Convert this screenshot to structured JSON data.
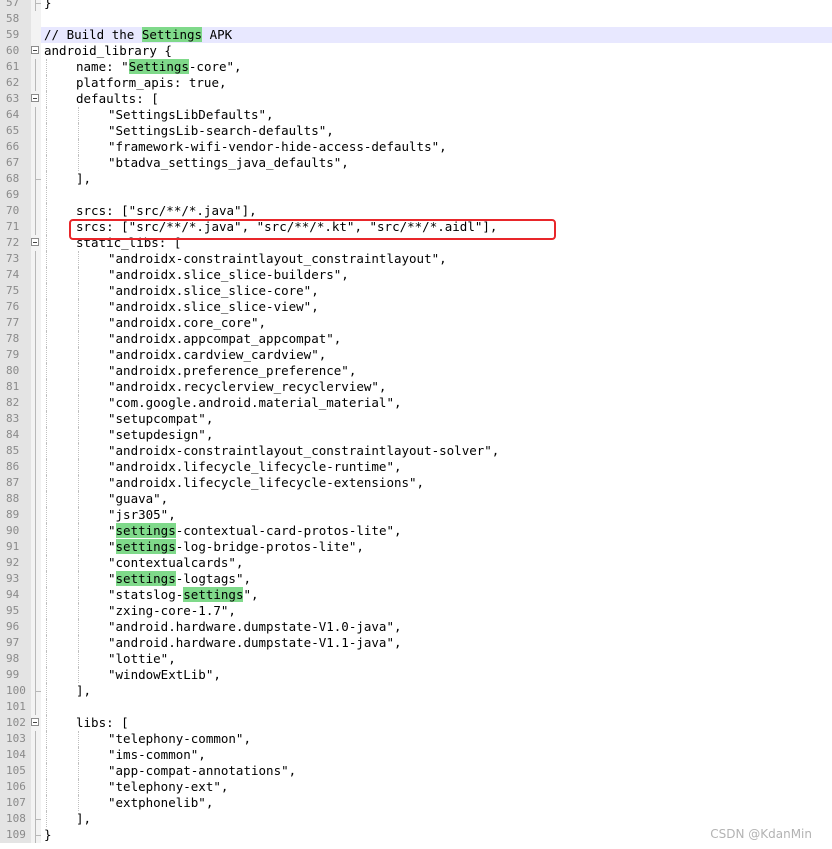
{
  "editor": {
    "lines": [
      {
        "n": "57",
        "text": "}",
        "indent": 0
      },
      {
        "n": "58",
        "text": "",
        "indent": 0
      },
      {
        "n": "59",
        "text": "// Build the Settings APK",
        "indent": 0,
        "highlight": "Settings",
        "current": true
      },
      {
        "n": "60",
        "text": "android_library {",
        "indent": 0
      },
      {
        "n": "61",
        "text": "name: \"Settings-core\",",
        "indent": 1,
        "highlight": "Settings"
      },
      {
        "n": "62",
        "text": "platform_apis: true,",
        "indent": 1
      },
      {
        "n": "63",
        "text": "defaults: [",
        "indent": 1
      },
      {
        "n": "64",
        "text": "\"SettingsLibDefaults\",",
        "indent": 2
      },
      {
        "n": "65",
        "text": "\"SettingsLib-search-defaults\",",
        "indent": 2
      },
      {
        "n": "66",
        "text": "\"framework-wifi-vendor-hide-access-defaults\",",
        "indent": 2
      },
      {
        "n": "67",
        "text": "\"btadva_settings_java_defaults\",",
        "indent": 2
      },
      {
        "n": "68",
        "text": "],",
        "indent": 1
      },
      {
        "n": "69",
        "text": "",
        "indent": 1
      },
      {
        "n": "70",
        "text": "srcs: [\"src/**/*.java\"],",
        "indent": 1
      },
      {
        "n": "71",
        "text": "srcs: [\"src/**/*.java\", \"src/**/*.kt\", \"src/**/*.aidl\"],",
        "indent": 1
      },
      {
        "n": "72",
        "text": "static_libs: [",
        "indent": 1
      },
      {
        "n": "73",
        "text": "\"androidx-constraintlayout_constraintlayout\",",
        "indent": 2
      },
      {
        "n": "74",
        "text": "\"androidx.slice_slice-builders\",",
        "indent": 2
      },
      {
        "n": "75",
        "text": "\"androidx.slice_slice-core\",",
        "indent": 2
      },
      {
        "n": "76",
        "text": "\"androidx.slice_slice-view\",",
        "indent": 2
      },
      {
        "n": "77",
        "text": "\"androidx.core_core\",",
        "indent": 2
      },
      {
        "n": "78",
        "text": "\"androidx.appcompat_appcompat\",",
        "indent": 2
      },
      {
        "n": "79",
        "text": "\"androidx.cardview_cardview\",",
        "indent": 2
      },
      {
        "n": "80",
        "text": "\"androidx.preference_preference\",",
        "indent": 2
      },
      {
        "n": "81",
        "text": "\"androidx.recyclerview_recyclerview\",",
        "indent": 2
      },
      {
        "n": "82",
        "text": "\"com.google.android.material_material\",",
        "indent": 2
      },
      {
        "n": "83",
        "text": "\"setupcompat\",",
        "indent": 2
      },
      {
        "n": "84",
        "text": "\"setupdesign\",",
        "indent": 2
      },
      {
        "n": "85",
        "text": "\"androidx-constraintlayout_constraintlayout-solver\",",
        "indent": 2
      },
      {
        "n": "86",
        "text": "\"androidx.lifecycle_lifecycle-runtime\",",
        "indent": 2
      },
      {
        "n": "87",
        "text": "\"androidx.lifecycle_lifecycle-extensions\",",
        "indent": 2
      },
      {
        "n": "88",
        "text": "\"guava\",",
        "indent": 2
      },
      {
        "n": "89",
        "text": "\"jsr305\",",
        "indent": 2
      },
      {
        "n": "90",
        "text": "\"settings-contextual-card-protos-lite\",",
        "indent": 2,
        "highlight": "settings"
      },
      {
        "n": "91",
        "text": "\"settings-log-bridge-protos-lite\",",
        "indent": 2,
        "highlight": "settings"
      },
      {
        "n": "92",
        "text": "\"contextualcards\",",
        "indent": 2
      },
      {
        "n": "93",
        "text": "\"settings-logtags\",",
        "indent": 2,
        "highlight": "settings"
      },
      {
        "n": "94",
        "text": "\"statslog-settings\",",
        "indent": 2,
        "highlight": "settings"
      },
      {
        "n": "95",
        "text": "\"zxing-core-1.7\",",
        "indent": 2
      },
      {
        "n": "96",
        "text": "\"android.hardware.dumpstate-V1.0-java\",",
        "indent": 2
      },
      {
        "n": "97",
        "text": "\"android.hardware.dumpstate-V1.1-java\",",
        "indent": 2
      },
      {
        "n": "98",
        "text": "\"lottie\",",
        "indent": 2
      },
      {
        "n": "99",
        "text": "\"windowExtLib\",",
        "indent": 2
      },
      {
        "n": "100",
        "text": "],",
        "indent": 1
      },
      {
        "n": "101",
        "text": "",
        "indent": 1
      },
      {
        "n": "102",
        "text": "libs: [",
        "indent": 1
      },
      {
        "n": "103",
        "text": "\"telephony-common\",",
        "indent": 2
      },
      {
        "n": "104",
        "text": "\"ims-common\",",
        "indent": 2
      },
      {
        "n": "105",
        "text": "\"app-compat-annotations\",",
        "indent": 2
      },
      {
        "n": "106",
        "text": "\"telephony-ext\",",
        "indent": 2
      },
      {
        "n": "107",
        "text": "\"extphonelib\",",
        "indent": 2
      },
      {
        "n": "108",
        "text": "],",
        "indent": 1
      },
      {
        "n": "109",
        "text": "}",
        "indent": 0
      }
    ]
  },
  "annotation": {
    "highlighted_line": "71",
    "color": "#e8262a"
  },
  "watermark": "CSDN @KdanMin"
}
